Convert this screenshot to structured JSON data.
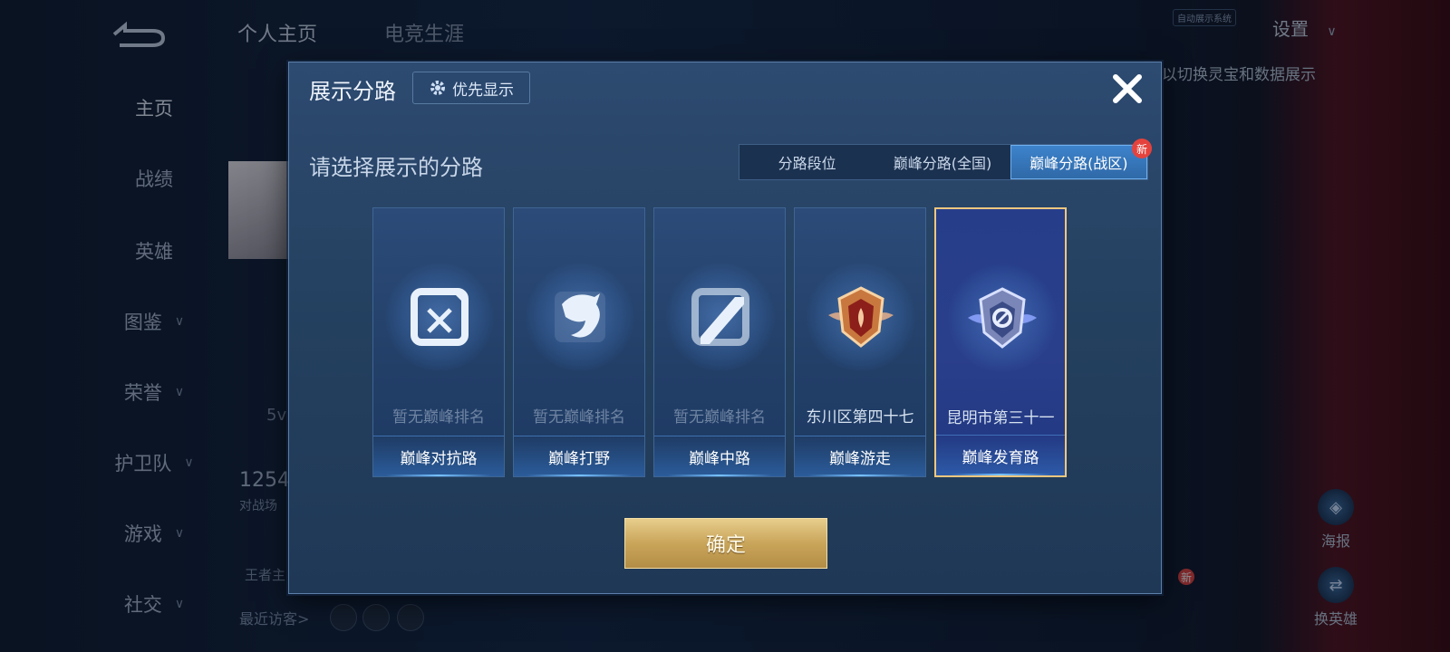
{
  "background": {
    "top_tabs": [
      "个人主页",
      "电竞生涯"
    ],
    "nav": [
      "主页",
      "战绩",
      "英雄",
      "图鉴",
      "荣誉",
      "护卫队",
      "游戏",
      "社交"
    ],
    "nav_has_chevron": [
      false,
      false,
      false,
      true,
      true,
      true,
      true,
      true
    ],
    "settings_label": "设置",
    "top_badge": "自动展示系统",
    "hint_text": "以切换灵宝和数据展示",
    "partial_stats": {
      "value": "1254",
      "label": "对战场",
      "king": "王者主",
      "level_fragment": "5v"
    },
    "visitors_label": "最近访客>",
    "side_buttons": [
      {
        "label": "海报",
        "icon": "poster-icon"
      },
      {
        "label": "换英雄",
        "icon": "swap-hero-icon"
      }
    ],
    "side_new_badge": "新"
  },
  "dialog": {
    "title": "展示分路",
    "priority_button": "优先显示",
    "subtitle": "请选择展示的分路",
    "tabs": [
      {
        "label": "分路段位",
        "active": false
      },
      {
        "label": "巅峰分路(全国)",
        "active": false
      },
      {
        "label": "巅峰分路(战区)",
        "active": true,
        "badge": "新"
      }
    ],
    "cards": [
      {
        "name": "巅峰对抗路",
        "rank": "暂无巅峰排名",
        "ranked": false,
        "selected": false,
        "icon": "clash-lane-icon"
      },
      {
        "name": "巅峰打野",
        "rank": "暂无巅峰排名",
        "ranked": false,
        "selected": false,
        "icon": "jungle-dragon-icon"
      },
      {
        "name": "巅峰中路",
        "rank": "暂无巅峰排名",
        "ranked": false,
        "selected": false,
        "icon": "mid-lane-icon"
      },
      {
        "name": "巅峰游走",
        "rank": "东川区第四十七",
        "ranked": true,
        "selected": false,
        "icon": "roam-badge-icon"
      },
      {
        "name": "巅峰发育路",
        "rank": "昆明市第三十一",
        "ranked": true,
        "selected": true,
        "icon": "farm-lane-badge-icon"
      }
    ],
    "confirm_label": "确定"
  },
  "colors": {
    "accent_gold": "#f0c77e",
    "active_tab": "#3d83cc",
    "badge_red": "#e4433d"
  }
}
